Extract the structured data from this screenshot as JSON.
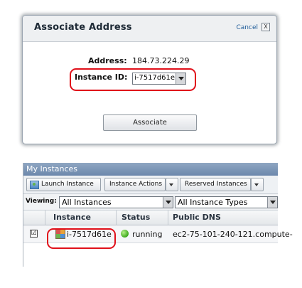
{
  "dialog": {
    "title": "Associate Address",
    "cancel_label": "Cancel",
    "close_glyph": "X",
    "address_label": "Address:",
    "address_value": "184.73.224.29",
    "instance_label": "Instance ID:",
    "instance_value": "i-7517d61e",
    "associate_label": "Associate"
  },
  "panel": {
    "title": "My Instances",
    "toolbar": {
      "launch_label": "Launch Instance",
      "actions_label": "Instance Actions",
      "reserved_label": "Reserved Instances"
    },
    "filter": {
      "viewing_label": "Viewing:",
      "instances_value": "All Instances",
      "types_value": "All Instance Types"
    },
    "columns": [
      "Instance",
      "Status",
      "Public DNS"
    ],
    "rows": [
      {
        "checked_glyph": "☑",
        "instance": "i-7517d61e",
        "status": "running",
        "public_dns": "ec2-75-101-240-121.compute-"
      }
    ]
  },
  "colors": {
    "highlight": "#e0101a",
    "title_bar": "#6c88ac",
    "link": "#1f5c99",
    "running": "#3da91c"
  },
  "icons": {
    "close": "close-icon",
    "dropdown": "chevron-down-icon",
    "launch": "launch-instance-icon",
    "instance": "instance-icon",
    "status": "running-status-icon"
  }
}
